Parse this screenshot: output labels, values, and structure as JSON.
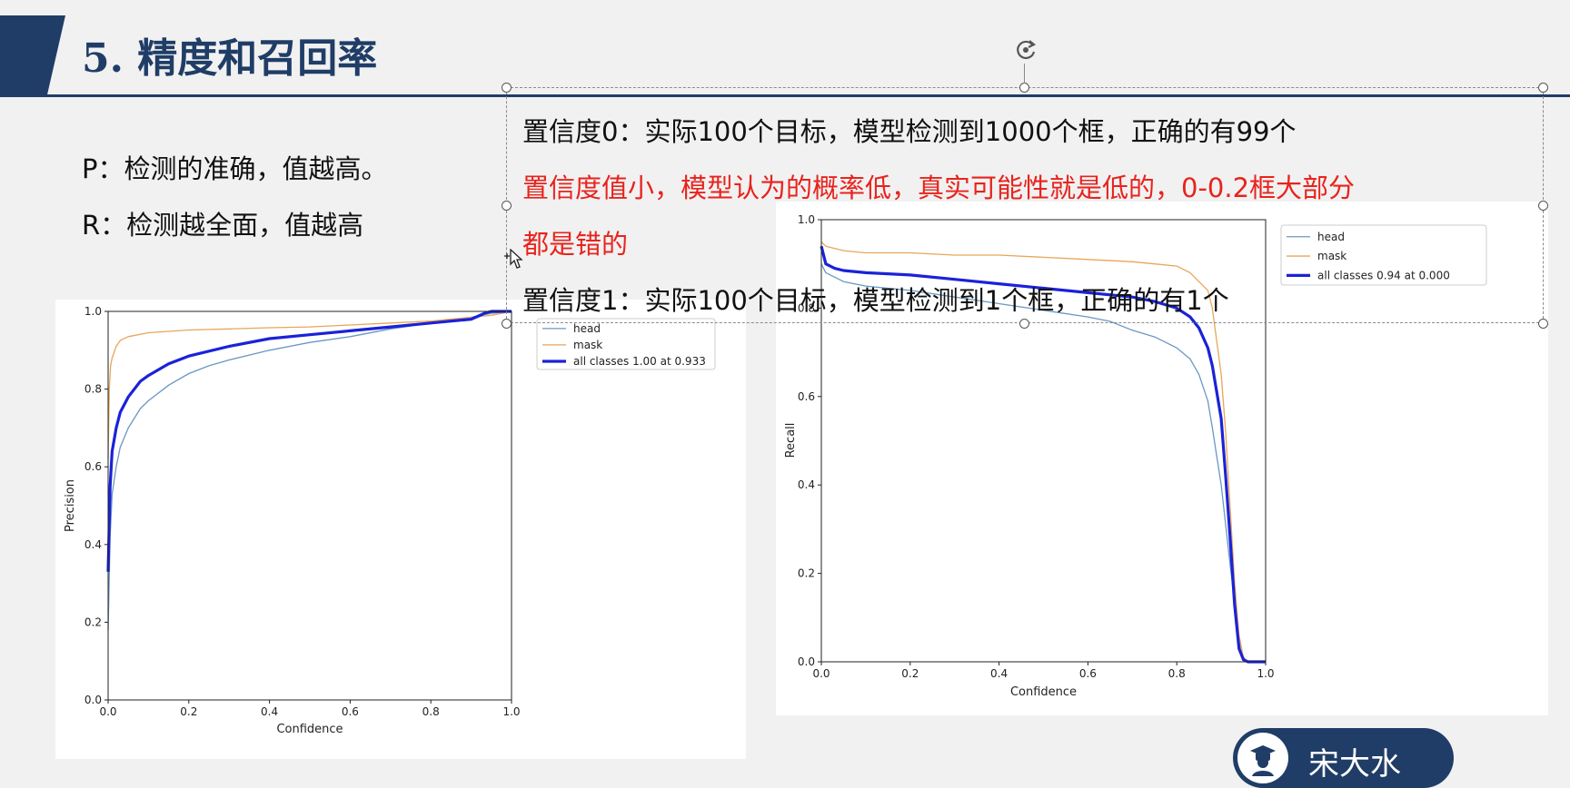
{
  "slide": {
    "title": "5. 精度和召回率",
    "p_line": "P：检测的准确，值越高。",
    "r_line": "R：检测越全面，值越高"
  },
  "textbox": {
    "line1": "置信度0：实际100个目标，模型检测到1000个框，正确的有99个",
    "line2a": "置信度值小，模型认为的概率低，真实可能性就是低的，0-0.2框大部分",
    "line2b": "都是错的",
    "line3": "置信度1：实际100个目标，模型检测到1个框，正确的有1个"
  },
  "author": {
    "name": "宋大水",
    "icon": "graduate-avatar-icon"
  },
  "colors": {
    "head": "#6a97c2",
    "mask": "#e8a658",
    "all": "#1a22d8",
    "brand": "#1f3d66",
    "accent_red": "#e8231d"
  },
  "chart_data": [
    {
      "type": "line",
      "xlabel": "Confidence",
      "ylabel": "Precision",
      "xlim": [
        0,
        1
      ],
      "ylim": [
        0,
        1
      ],
      "xticks": [
        "0.0",
        "0.2",
        "0.4",
        "0.6",
        "0.8",
        "1.0"
      ],
      "yticks": [
        "0.0",
        "0.2",
        "0.4",
        "0.6",
        "0.8",
        "1.0"
      ],
      "legend_placement": "outside-top-right",
      "grid": false,
      "series": [
        {
          "name": "head",
          "x": [
            0,
            0.005,
            0.01,
            0.02,
            0.03,
            0.05,
            0.08,
            0.1,
            0.15,
            0.2,
            0.25,
            0.3,
            0.4,
            0.5,
            0.6,
            0.7,
            0.8,
            0.9,
            0.95,
            1.0
          ],
          "values": [
            0.18,
            0.42,
            0.53,
            0.6,
            0.65,
            0.7,
            0.75,
            0.77,
            0.81,
            0.84,
            0.86,
            0.875,
            0.9,
            0.92,
            0.935,
            0.955,
            0.97,
            0.985,
            0.995,
            1.0
          ]
        },
        {
          "name": "mask",
          "x": [
            0,
            0.003,
            0.006,
            0.01,
            0.02,
            0.03,
            0.05,
            0.1,
            0.2,
            0.3,
            0.4,
            0.5,
            0.6,
            0.7,
            0.8,
            0.9,
            0.95,
            1.0
          ],
          "values": [
            0.62,
            0.8,
            0.86,
            0.88,
            0.91,
            0.925,
            0.935,
            0.945,
            0.952,
            0.955,
            0.958,
            0.96,
            0.965,
            0.97,
            0.975,
            0.985,
            0.99,
            1.0
          ]
        },
        {
          "name": "all classes 1.00 at 0.933",
          "x": [
            0,
            0.005,
            0.01,
            0.02,
            0.03,
            0.05,
            0.08,
            0.1,
            0.15,
            0.2,
            0.3,
            0.4,
            0.5,
            0.6,
            0.7,
            0.8,
            0.9,
            0.933,
            0.95,
            1.0
          ],
          "values": [
            0.33,
            0.55,
            0.64,
            0.7,
            0.74,
            0.78,
            0.82,
            0.835,
            0.865,
            0.885,
            0.91,
            0.93,
            0.94,
            0.95,
            0.96,
            0.97,
            0.98,
            0.995,
            1.0,
            1.0
          ]
        }
      ]
    },
    {
      "type": "line",
      "xlabel": "Confidence",
      "ylabel": "Recall",
      "xlim": [
        0,
        1
      ],
      "ylim": [
        0,
        1
      ],
      "xticks": [
        "0.0",
        "0.2",
        "0.4",
        "0.6",
        "0.8",
        "1.0"
      ],
      "yticks": [
        "0.0",
        "0.2",
        "0.4",
        "0.6",
        "0.8",
        "1.0"
      ],
      "legend_placement": "outside-top-right",
      "grid": false,
      "series": [
        {
          "name": "head",
          "x": [
            0,
            0.01,
            0.05,
            0.1,
            0.2,
            0.3,
            0.4,
            0.5,
            0.6,
            0.65,
            0.7,
            0.75,
            0.8,
            0.83,
            0.85,
            0.87,
            0.88,
            0.9,
            0.92,
            0.94,
            0.95,
            0.96,
            1.0
          ],
          "values": [
            0.9,
            0.88,
            0.86,
            0.85,
            0.84,
            0.825,
            0.81,
            0.795,
            0.78,
            0.77,
            0.75,
            0.735,
            0.71,
            0.685,
            0.65,
            0.59,
            0.53,
            0.4,
            0.22,
            0.05,
            0.01,
            0.0,
            0.0
          ]
        },
        {
          "name": "mask",
          "x": [
            0,
            0.01,
            0.05,
            0.1,
            0.2,
            0.3,
            0.4,
            0.5,
            0.6,
            0.7,
            0.75,
            0.8,
            0.83,
            0.85,
            0.87,
            0.88,
            0.9,
            0.91,
            0.92,
            0.93,
            0.94,
            0.95,
            0.96,
            1.0
          ],
          "values": [
            0.95,
            0.94,
            0.93,
            0.925,
            0.925,
            0.92,
            0.92,
            0.915,
            0.91,
            0.905,
            0.9,
            0.895,
            0.88,
            0.86,
            0.84,
            0.8,
            0.65,
            0.52,
            0.35,
            0.18,
            0.06,
            0.01,
            0.0,
            0.0
          ]
        },
        {
          "name": "all classes 0.94 at 0.000",
          "x": [
            0,
            0.01,
            0.03,
            0.05,
            0.1,
            0.2,
            0.3,
            0.4,
            0.5,
            0.6,
            0.7,
            0.75,
            0.8,
            0.83,
            0.85,
            0.87,
            0.88,
            0.9,
            0.91,
            0.92,
            0.93,
            0.94,
            0.95,
            0.96,
            1.0
          ],
          "values": [
            0.94,
            0.9,
            0.89,
            0.885,
            0.88,
            0.875,
            0.865,
            0.855,
            0.845,
            0.835,
            0.825,
            0.815,
            0.8,
            0.78,
            0.755,
            0.71,
            0.67,
            0.55,
            0.42,
            0.28,
            0.13,
            0.03,
            0.005,
            0.0,
            0.0
          ]
        }
      ]
    }
  ]
}
